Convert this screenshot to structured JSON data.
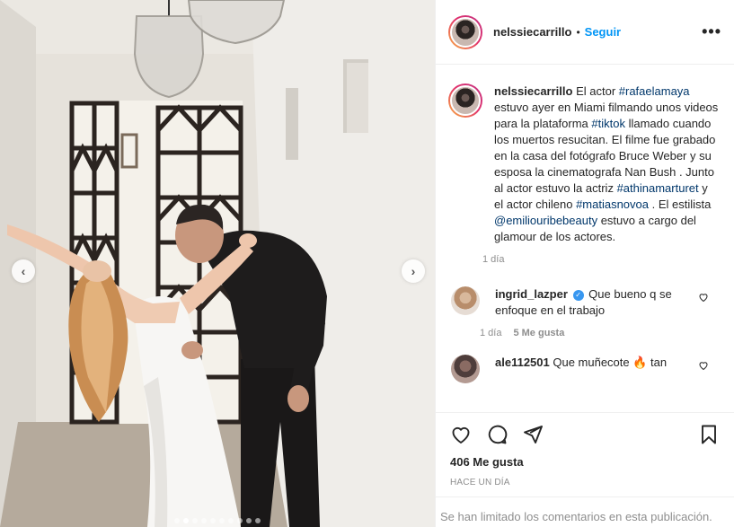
{
  "post": {
    "username": "nelssiecarrillo",
    "follow_separator": "•",
    "follow_label": "Seguir",
    "more_icon": "more-horizontal-icon",
    "options_glyph": "•••"
  },
  "caption": {
    "username": "nelssiecarrillo",
    "text_1": "El actor ",
    "tag_1": "#rafaelamaya",
    "text_2": " estuvo ayer en Miami filmando unos videos para la plataforma ",
    "tag_2": "#tiktok",
    "text_3": " llamado cuando los muertos resucitan. El filme fue grabado en la casa del fotógrafo Bruce Weber y su esposa la cinematografa Nan Bush . Junto al actor estuvo la actriz ",
    "tag_3": "#athinamarturet",
    "text_4": " y el actor chileno ",
    "tag_4": "#matiasnovoa",
    "text_5": " . El estilista ",
    "tag_5": "@emiliouribebeauty",
    "text_6": " estuvo a cargo del glamour de los actores.",
    "time": "1 día"
  },
  "comments": [
    {
      "username": "ingrid_lazper",
      "verified_glyph": "✓",
      "text": " Que bueno q se enfoque en el trabajo",
      "time": "1 día",
      "likes": "5 Me gusta"
    },
    {
      "username": "ale112501",
      "text": " Que muñecote 🔥 tan"
    }
  ],
  "actions": {
    "like_count": "406 Me gusta",
    "time_ago": "Hace un día",
    "icons": [
      "heart-icon",
      "comment-icon",
      "share-icon",
      "bookmark-icon"
    ]
  },
  "footer": {
    "limited_text": "Se han limitado los comentarios en esta publicación."
  },
  "carousel": {
    "prev_glyph": "‹",
    "next_glyph": "›",
    "dot_count": 10,
    "active_dot": 1
  },
  "colors": {
    "link": "#00376b",
    "follow": "#0095f6",
    "verified": "#3897f0",
    "secondary_text": "#8e8e8e",
    "border": "#efefef"
  }
}
